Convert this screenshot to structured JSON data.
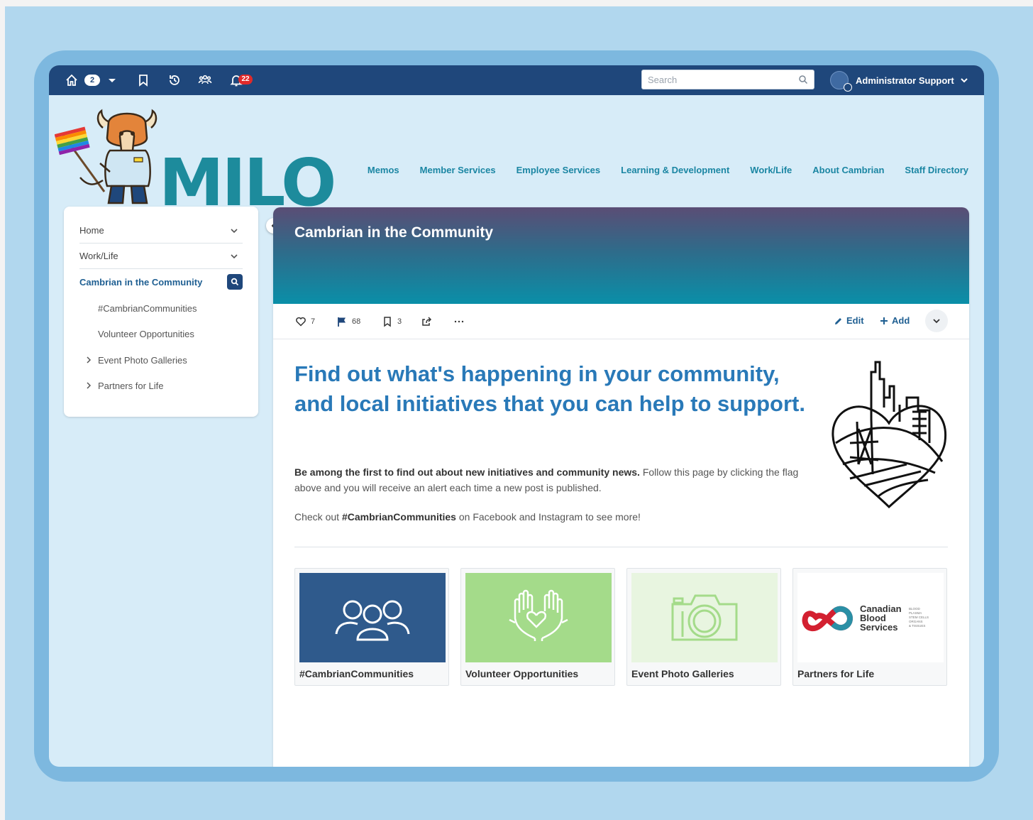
{
  "topbar": {
    "home_count": "2",
    "notification_count": "22",
    "search_placeholder": "Search",
    "user_name": "Administrator Support"
  },
  "logo": {
    "text": "MILO"
  },
  "nav": [
    "Memos",
    "Member Services",
    "Employee Services",
    "Learning & Development",
    "Work/Life",
    "About Cambrian",
    "Staff Directory"
  ],
  "sidebar": {
    "items": [
      {
        "label": "Home"
      },
      {
        "label": "Work/Life"
      },
      {
        "label": "Cambrian in the Community"
      }
    ],
    "subitems": [
      {
        "label": "#CambrianCommunities"
      },
      {
        "label": "Volunteer Opportunities"
      },
      {
        "label": "Event Photo Galleries"
      },
      {
        "label": "Partners for Life"
      }
    ]
  },
  "page": {
    "title": "Cambrian in the Community",
    "likes": "7",
    "follows": "68",
    "bookmarks": "3",
    "edit_label": "Edit",
    "add_label": "Add",
    "headline": "Find out what's happening in your community, and local initiatives that you can help to support.",
    "para1_bold": "Be among the first to find out about new initiatives and community news.",
    "para1_rest": " Follow this page by clicking the flag above and you will receive an alert each time a new post is published.",
    "para2_pre": "Check out ",
    "para2_bold": "#CambrianCommunities",
    "para2_post": " on Facebook and Instagram to see more!"
  },
  "cards": [
    {
      "label": "#CambrianCommunities",
      "bg": "#2f5a8c"
    },
    {
      "label": "Volunteer Opportunities",
      "bg": "#a4db8a"
    },
    {
      "label": "Event Photo Galleries",
      "bg": "#e8f5e0"
    },
    {
      "label": "Partners for Life",
      "bg": "#ffffff",
      "logo_text": [
        "Canadian",
        "Blood",
        "Services"
      ],
      "logo_small": [
        "BLOOD",
        "PLASMA",
        "STEM CELLS",
        "ORGANS",
        "& TISSUES"
      ]
    }
  ],
  "colors": {
    "topbar": "#1f477b",
    "nav_link": "#1b86a3",
    "headline": "#2979b8",
    "logo": "#1d8b9c"
  }
}
